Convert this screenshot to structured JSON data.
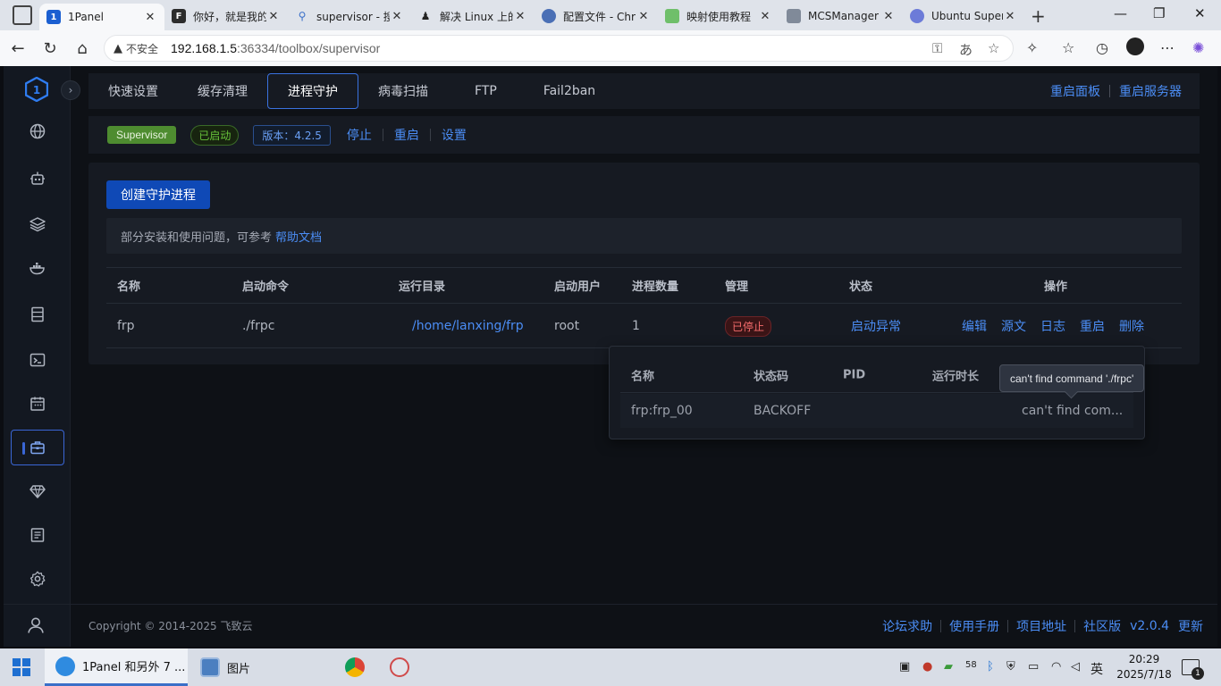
{
  "browser": {
    "tabs": [
      {
        "title": "1Panel",
        "color": "#1b5fd1",
        "glyph": "1",
        "active": true
      },
      {
        "title": "你好，就是我的",
        "color": "#2c2c2c",
        "glyph": "F",
        "active": false
      },
      {
        "title": "supervisor - 搜索",
        "color": "#ffffff",
        "glyph": "🔍",
        "active": false
      },
      {
        "title": "解决 Linux 上的",
        "color": "#ffffff",
        "glyph": "🐧",
        "active": false
      },
      {
        "title": "配置文件 - Chr",
        "color": "#4a6fb5",
        "glyph": "●",
        "active": false
      },
      {
        "title": "映射使用教程",
        "color": "#6fbf6a",
        "glyph": "▤",
        "active": false
      },
      {
        "title": "MCSManager",
        "color": "#808a99",
        "glyph": "▬",
        "active": false
      },
      {
        "title": "Ubuntu Super",
        "color": "#6c7bd8",
        "glyph": "⊙",
        "active": false
      }
    ],
    "address": {
      "insecure_label": "不安全",
      "host": "192.168.1.5",
      "path": ":36334/toolbox/supervisor"
    }
  },
  "topnav": {
    "tabs": [
      "快速设置",
      "缓存清理",
      "进程守护",
      "病毒扫描",
      "FTP",
      "Fail2ban"
    ],
    "active_index": 2,
    "restart_panel": "重启面板",
    "restart_server": "重启服务器"
  },
  "status": {
    "app_name": "Supervisor",
    "state": "已启动",
    "version": "版本：4.2.5",
    "stop": "停止",
    "restart": "重启",
    "settings": "设置"
  },
  "panel": {
    "create_button": "创建守护进程",
    "hint_text": "部分安装和使用问题，可参考",
    "hint_link": "帮助文档",
    "columns": [
      "名称",
      "启动命令",
      "运行目录",
      "启动用户",
      "进程数量",
      "管理",
      "状态",
      "操作"
    ],
    "row": {
      "name": "frp",
      "command": "./frpc",
      "dir": "/home/lanxing/frp",
      "user": "root",
      "count": "1",
      "manage": "已停止",
      "status": "启动异常",
      "ops": [
        "编辑",
        "源文",
        "日志",
        "重启",
        "删除"
      ]
    }
  },
  "popover": {
    "columns": [
      "名称",
      "状态码",
      "PID",
      "运行时长"
    ],
    "row": {
      "name": "frp:frp_00",
      "code": "BACKOFF",
      "pid": "",
      "uptime": "",
      "msg": "can't find com..."
    },
    "tooltip": "can't find command './frpc'"
  },
  "footer": {
    "copyright": "Copyright © 2014-2025 飞致云",
    "links": [
      "论坛求助",
      "使用手册",
      "项目地址",
      "社区版"
    ],
    "version": "v2.0.4",
    "update": "更新"
  },
  "taskbar": {
    "tasks": [
      {
        "label": "1Panel 和另外 7 ..."
      },
      {
        "label": "图片"
      }
    ],
    "ime": "英",
    "time": "20:29",
    "date": "2025/7/18",
    "notifications": "1"
  },
  "colors": {
    "accent": "#4b8df5",
    "success": "#67c23a",
    "danger": "#f56c6c",
    "primary_button": "#0f49b6"
  }
}
